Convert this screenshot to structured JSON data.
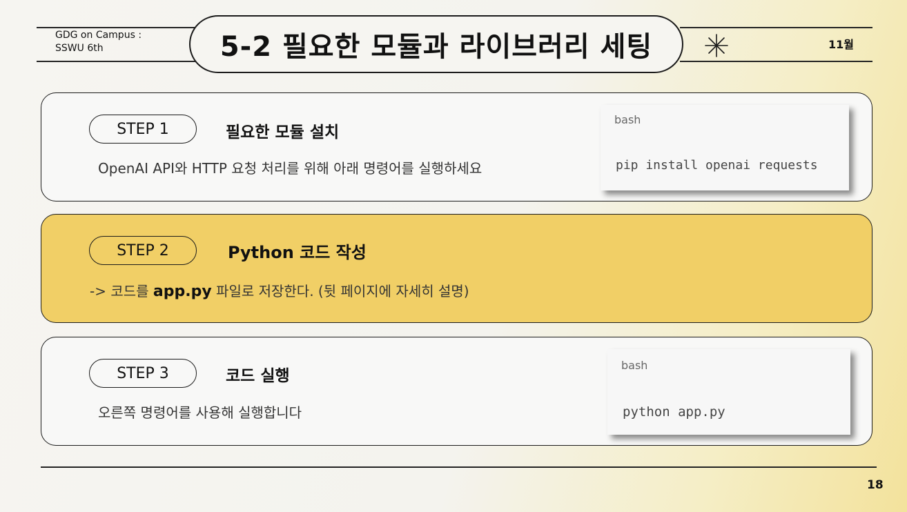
{
  "header": {
    "org": "GDG on Campus :\nSSWU 6th",
    "title": "5-2 필요한 모듈과 라이브러리 세팅",
    "month": "11월"
  },
  "steps": [
    {
      "label": "STEP 1",
      "title": "필요한 모듈 설치",
      "description": "OpenAI API와 HTTP 요청 처리를 위해 아래 명령어를 실행하세요",
      "code": {
        "lang": "bash",
        "command": "pip install openai requests"
      }
    },
    {
      "label": "STEP 2",
      "title": "Python 코드 작성",
      "description_prefix": "-> 코드를 ",
      "description_file": "app.py",
      "description_suffix": " 파일로 저장한다. (뒷 페이지에 자세히 설명)"
    },
    {
      "label": "STEP 3",
      "title": "코드 실행",
      "description": "오른쪽 명령어를 사용해 실행합니다",
      "code": {
        "lang": "bash",
        "command": "python app.py"
      }
    }
  ],
  "footer": {
    "page_number": "18"
  },
  "colors": {
    "highlight": "#f1cf66",
    "outline": "#1a1a1a"
  }
}
